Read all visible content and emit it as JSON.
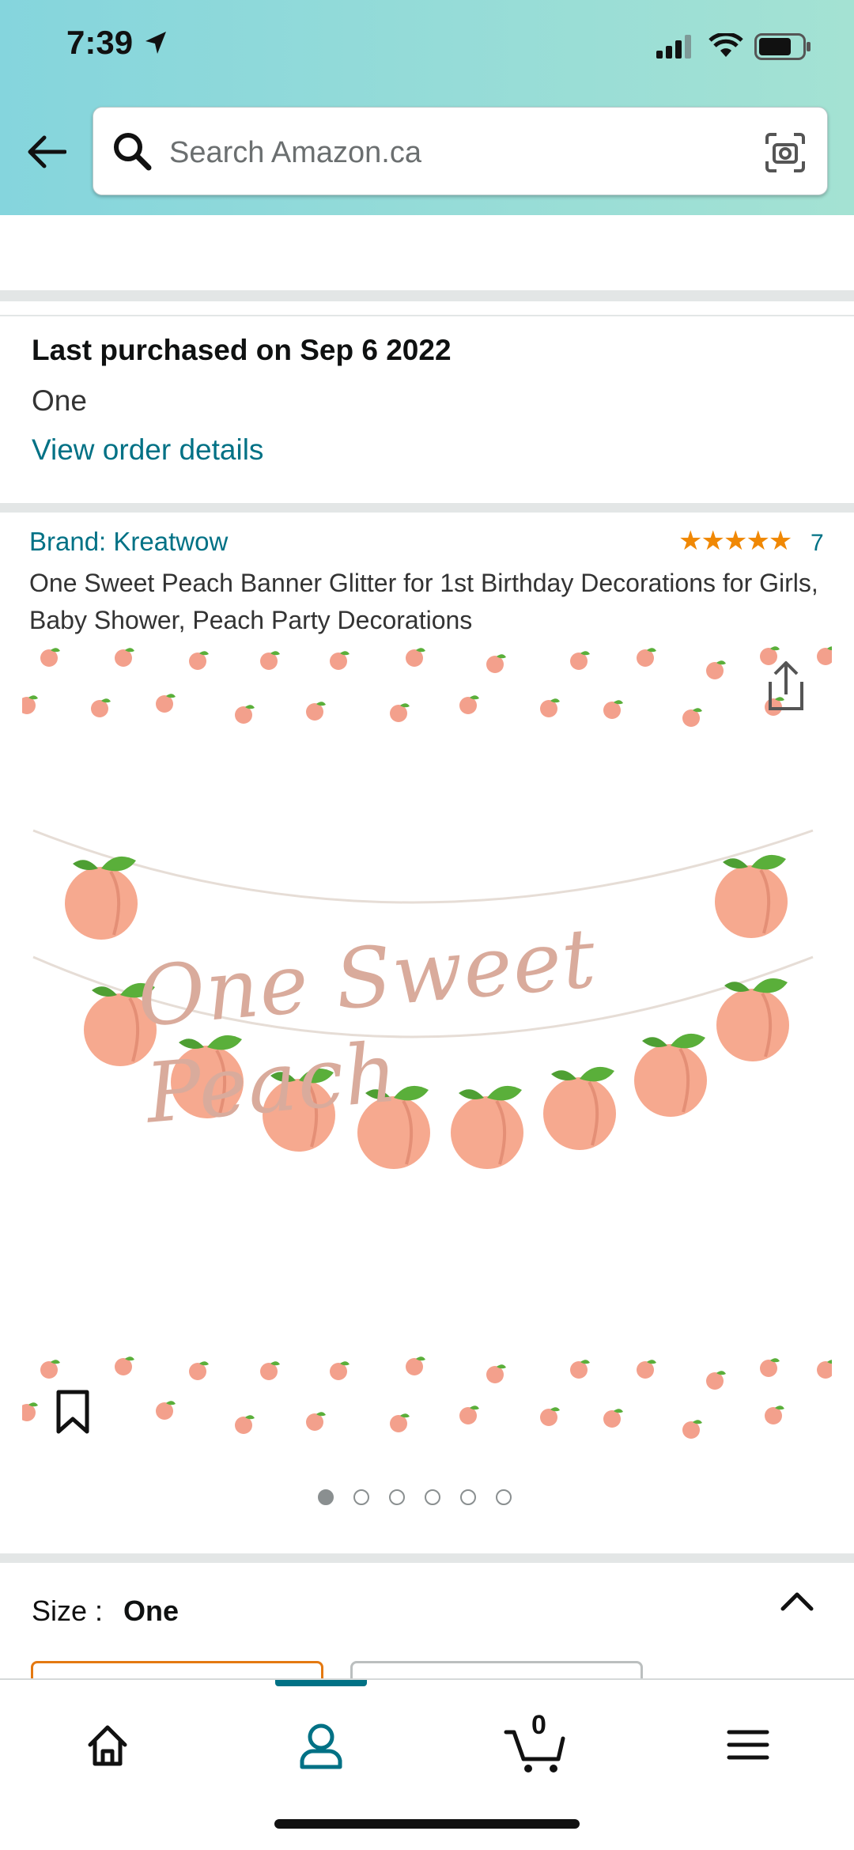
{
  "status_bar": {
    "time": "7:39"
  },
  "search": {
    "placeholder": "Search Amazon.ca"
  },
  "purchase": {
    "title": "Last purchased on Sep 6 2022",
    "quantity": "One",
    "link": "View order details"
  },
  "product": {
    "brand": "Brand: Kreatwow",
    "stars": "★★★★★",
    "rating_count": "7",
    "title": "One Sweet Peach Banner Glitter for 1st Birthday Decorations for Girls, Baby Shower, Peach Party Decorations",
    "image_text": "One Sweet Peach",
    "image_count": 6,
    "image_index": 1
  },
  "size": {
    "label": "Size :",
    "value": "One"
  },
  "nav": {
    "cart_count": "0",
    "items": [
      "home-icon",
      "account-icon",
      "cart-icon",
      "menu-icon"
    ]
  },
  "colors": {
    "accent": "#007185",
    "star": "#f08804",
    "peach": "#f4a58a",
    "leaf": "#5aaf3a"
  }
}
